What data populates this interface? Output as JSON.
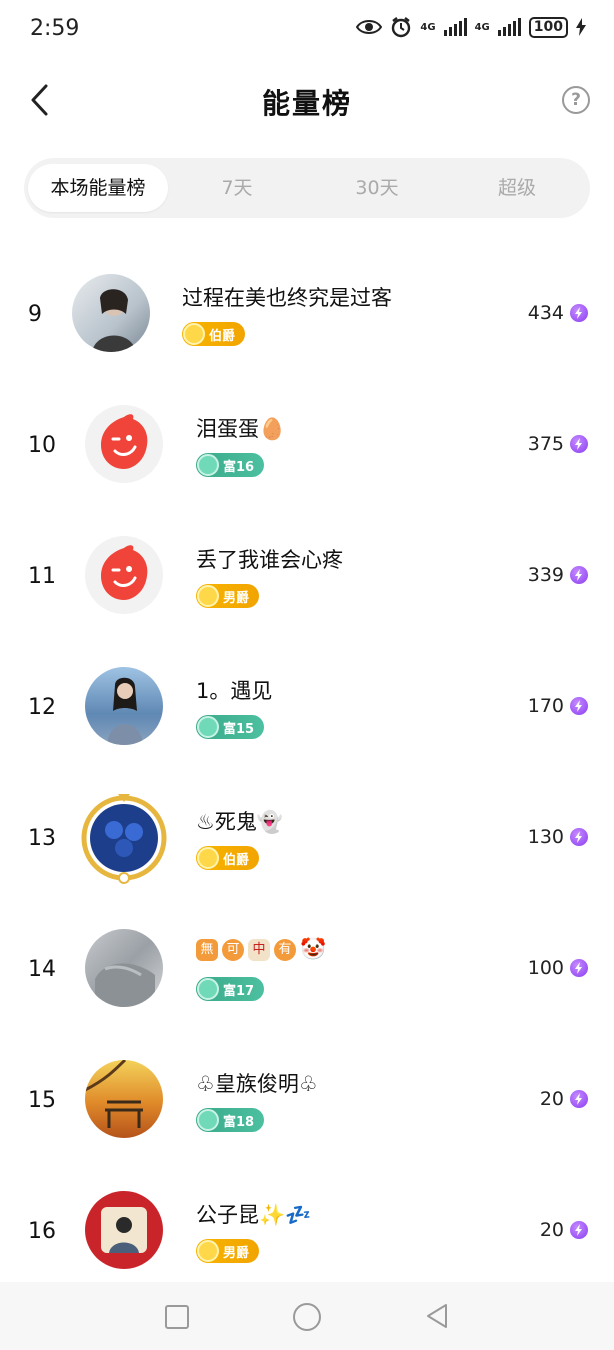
{
  "status_bar": {
    "time": "2:59",
    "battery": "100",
    "net1": "4G",
    "net2": "4G"
  },
  "header": {
    "title": "能量榜",
    "help": "?"
  },
  "tabs": [
    {
      "label": "本场能量榜",
      "active": true
    },
    {
      "label": "7天",
      "active": false
    },
    {
      "label": "30天",
      "active": false
    },
    {
      "label": "超级",
      "active": false
    }
  ],
  "rows": [
    {
      "rank": "9",
      "name": "过程在美也终究是过客",
      "badge": "伯爵",
      "badge_type": "gold",
      "score": "434"
    },
    {
      "rank": "10",
      "name": "泪蛋蛋",
      "name_suffix": "🥚",
      "badge": "富16",
      "badge_type": "green",
      "score": "375"
    },
    {
      "rank": "11",
      "name": "丢了我谁会心疼",
      "badge": "男爵",
      "badge_type": "gold",
      "score": "339"
    },
    {
      "rank": "12",
      "name": "1。遇见",
      "badge": "富15",
      "badge_type": "green",
      "score": "170"
    },
    {
      "rank": "13",
      "name": "♨死鬼",
      "name_suffix": "👻",
      "badge": "伯爵",
      "badge_type": "gold",
      "score": "130"
    },
    {
      "rank": "14",
      "name_chars": [
        "無",
        "可",
        "中",
        "有"
      ],
      "name_suffix": "🤡",
      "badge": "富17",
      "badge_type": "green",
      "score": "100"
    },
    {
      "rank": "15",
      "name": "♧皇族俊明♧",
      "badge": "富18",
      "badge_type": "green",
      "score": "20"
    },
    {
      "rank": "16",
      "name": "公子昆",
      "name_suffix": "✨💤",
      "badge": "男爵",
      "badge_type": "gold",
      "score": "20"
    }
  ],
  "colors": {
    "gold_badge": "#f7b500",
    "green_badge": "#3aa98a",
    "energy": "#8a3df0",
    "avatar_red": "#f0443a"
  }
}
